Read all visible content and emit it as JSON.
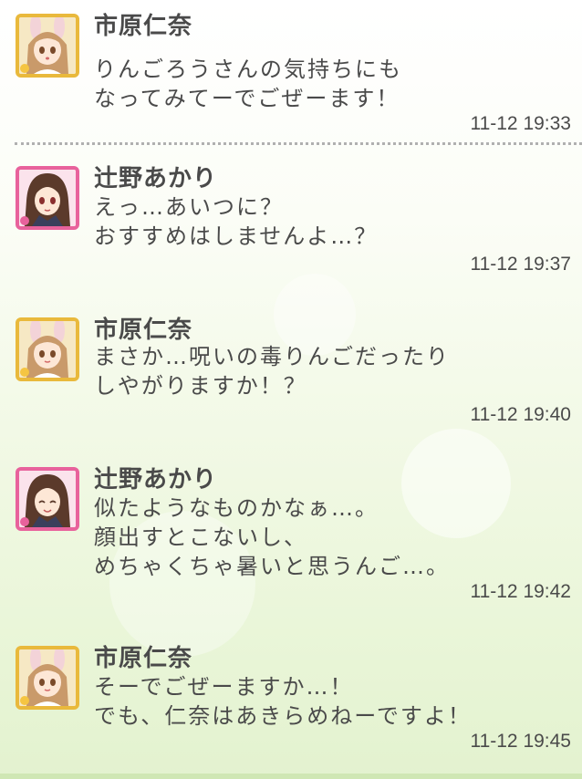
{
  "messages": [
    {
      "sender": "市原仁奈",
      "lines": [
        "りんごろうさんの気持ちにも",
        "なってみてーでごぜーます！"
      ],
      "time": "11-12 19:33",
      "avatar": "nina-avatar",
      "frame_color": "#e9b93c"
    },
    {
      "sender": "辻野あかり",
      "lines": [
        "えっ…あいつに？",
        "おすすめはしませんよ…？"
      ],
      "time": "11-12 19:37",
      "avatar": "akari-avatar",
      "frame_color": "#e8629c"
    },
    {
      "sender": "市原仁奈",
      "lines": [
        "まさか…呪いの毒りんごだったり",
        "しやがりますか！？"
      ],
      "time": "11-12 19:40",
      "avatar": "nina-avatar",
      "frame_color": "#e9b93c"
    },
    {
      "sender": "辻野あかり",
      "lines": [
        "似たようなものかなぁ…。",
        "顔出すとこないし、",
        "めちゃくちゃ暑いと思うんご…。"
      ],
      "time": "11-12 19:42",
      "avatar": "akari-avatar",
      "frame_color": "#e8629c"
    },
    {
      "sender": "市原仁奈",
      "lines": [
        "そーでごぜーますか…！",
        "でも、仁奈はあきらめねーですよ！"
      ],
      "time": "11-12 19:45",
      "avatar": "nina-avatar",
      "frame_color": "#e9b93c"
    }
  ]
}
